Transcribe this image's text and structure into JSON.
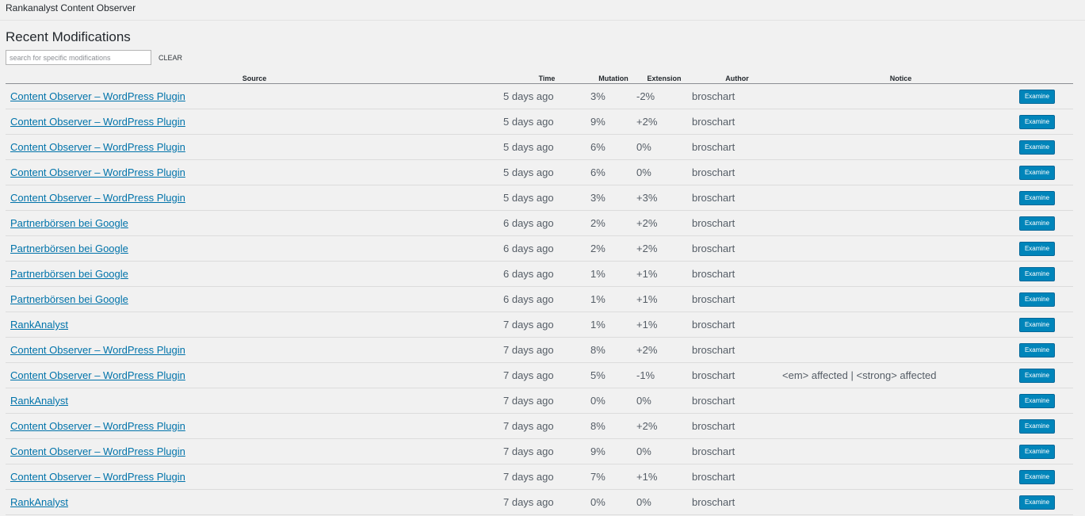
{
  "app": {
    "title": "Rankanalyst Content Observer"
  },
  "page": {
    "title": "Recent Modifications"
  },
  "search": {
    "placeholder": "search for specific modifications",
    "value": "",
    "clear_label": "CLEAR"
  },
  "table": {
    "headers": {
      "source": "Source",
      "time": "Time",
      "mutation": "Mutation",
      "extension": "Extension",
      "author": "Author",
      "notice": "Notice"
    },
    "rows": [
      {
        "source": "Content Observer – WordPress Plugin",
        "time": "5 days ago",
        "mutation": "3%",
        "extension": "-2%",
        "author": "broschart",
        "notice": "",
        "action": "Examine"
      },
      {
        "source": "Content Observer – WordPress Plugin",
        "time": "5 days ago",
        "mutation": "9%",
        "extension": "+2%",
        "author": "broschart",
        "notice": "",
        "action": "Examine"
      },
      {
        "source": "Content Observer – WordPress Plugin",
        "time": "5 days ago",
        "mutation": "6%",
        "extension": "0%",
        "author": "broschart",
        "notice": "",
        "action": "Examine"
      },
      {
        "source": "Content Observer – WordPress Plugin",
        "time": "5 days ago",
        "mutation": "6%",
        "extension": "0%",
        "author": "broschart",
        "notice": "",
        "action": "Examine"
      },
      {
        "source": "Content Observer – WordPress Plugin",
        "time": "5 days ago",
        "mutation": "3%",
        "extension": "+3%",
        "author": "broschart",
        "notice": "",
        "action": "Examine"
      },
      {
        "source": "Partnerbörsen bei Google",
        "time": "6 days ago",
        "mutation": "2%",
        "extension": "+2%",
        "author": "broschart",
        "notice": "",
        "action": "Examine"
      },
      {
        "source": "Partnerbörsen bei Google",
        "time": "6 days ago",
        "mutation": "2%",
        "extension": "+2%",
        "author": "broschart",
        "notice": "",
        "action": "Examine"
      },
      {
        "source": "Partnerbörsen bei Google",
        "time": "6 days ago",
        "mutation": "1%",
        "extension": "+1%",
        "author": "broschart",
        "notice": "",
        "action": "Examine"
      },
      {
        "source": "Partnerbörsen bei Google",
        "time": "6 days ago",
        "mutation": "1%",
        "extension": "+1%",
        "author": "broschart",
        "notice": "",
        "action": "Examine"
      },
      {
        "source": "RankAnalyst",
        "time": "7 days ago",
        "mutation": "1%",
        "extension": "+1%",
        "author": "broschart",
        "notice": "",
        "action": "Examine"
      },
      {
        "source": "Content Observer – WordPress Plugin",
        "time": "7 days ago",
        "mutation": "8%",
        "extension": "+2%",
        "author": "broschart",
        "notice": "",
        "action": "Examine"
      },
      {
        "source": "Content Observer – WordPress Plugin",
        "time": "7 days ago",
        "mutation": "5%",
        "extension": "-1%",
        "author": "broschart",
        "notice": "<em> affected | <strong> affected",
        "action": "Examine"
      },
      {
        "source": "RankAnalyst",
        "time": "7 days ago",
        "mutation": "0%",
        "extension": "0%",
        "author": "broschart",
        "notice": "",
        "action": "Examine"
      },
      {
        "source": "Content Observer – WordPress Plugin",
        "time": "7 days ago",
        "mutation": "8%",
        "extension": "+2%",
        "author": "broschart",
        "notice": "",
        "action": "Examine"
      },
      {
        "source": "Content Observer – WordPress Plugin",
        "time": "7 days ago",
        "mutation": "9%",
        "extension": "0%",
        "author": "broschart",
        "notice": "",
        "action": "Examine"
      },
      {
        "source": "Content Observer – WordPress Plugin",
        "time": "7 days ago",
        "mutation": "7%",
        "extension": "+1%",
        "author": "broschart",
        "notice": "",
        "action": "Examine"
      },
      {
        "source": "RankAnalyst",
        "time": "7 days ago",
        "mutation": "0%",
        "extension": "0%",
        "author": "broschart",
        "notice": "",
        "action": "Examine"
      }
    ]
  },
  "colors": {
    "link": "#0073aa",
    "button": "#0085ba",
    "background": "#f1f1f1"
  }
}
